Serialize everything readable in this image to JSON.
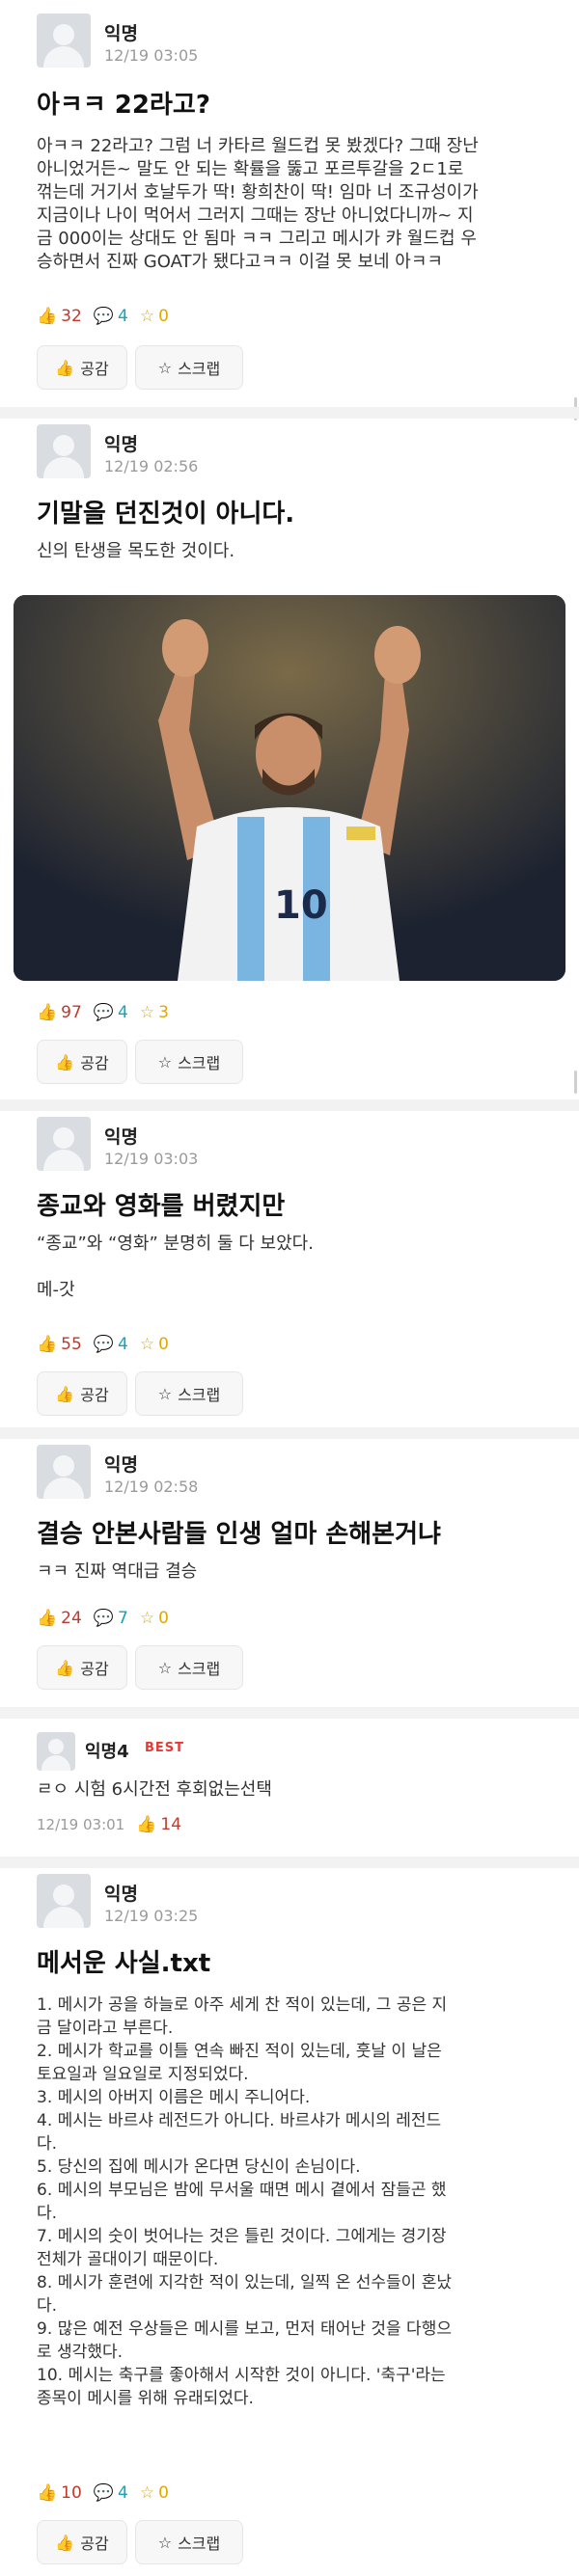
{
  "posts": [
    {
      "author": "익명",
      "date": "12/19 03:05",
      "title": "아ㅋㅋ 22라고?",
      "body": "아ㅋㅋ 22라고? 그럼 너 카타르 월드컵 못 봤겠다? 그때 장난\n아니었거든~ 말도 안 되는 확률을 뚫고 포르투갈을 2ㄷ1로\n꺾는데 거기서 호날두가 딱! 황희찬이 딱! 임마 너 조규성이가\n지금이나 나이 먹어서 그러지 그때는 장난 아니었다니까~ 지\n금 000이는 상대도 안 됨마 ㅋㅋ 그리고 메시가 캬 월드컵 우\n승하면서 진짜 GOAT가 됐다고ㅋㅋ 이걸 못 보네 아ㅋㅋ",
      "likes": "32",
      "comments": "4",
      "scraps": "0"
    },
    {
      "author": "익명",
      "date": "12/19 02:56",
      "title": "기말을 던진것이 아니다.",
      "body": "신의 탄생을 목도한 것이다.",
      "likes": "97",
      "comments": "4",
      "scraps": "3"
    },
    {
      "author": "익명",
      "date": "12/19 03:03",
      "title": "종교와 영화를 버렸지만",
      "body": "“종교”와 “영화” 분명히 둘 다 보았다.\n\n메-갓",
      "likes": "55",
      "comments": "4",
      "scraps": "0"
    },
    {
      "author": "익명",
      "date": "12/19 02:58",
      "title": "결승 안본사람들 인생 얼마 손해본거냐",
      "body": "ㅋㅋ 진짜 역대급 결승",
      "likes": "24",
      "comments": "7",
      "scraps": "0"
    },
    {
      "author": "익명",
      "date": "12/19 03:25",
      "title": "메서운 사실.txt",
      "body": "1. 메시가 공을 하늘로 아주 세게 찬 적이 있는데, 그 공은 지\n금 달이라고 부른다.\n2. 메시가 학교를 이틀 연속 빠진 적이 있는데, 훗날 이 날은\n토요일과 일요일로 지정되었다.\n3. 메시의 아버지 이름은 메시 주니어다.\n4. 메시는 바르샤 레전드가 아니다. 바르샤가 메시의 레전드\n다.\n5. 당신의 집에 메시가 온다면 당신이 손님이다.\n6. 메시의 부모님은 밤에 무서울 때면 메시 곁에서 잠들곤 했\n다.\n7. 메시의 숫이 벗어나는 것은 틀린 것이다. 그에게는 경기장\n전체가 골대이기 때문이다.\n8. 메시가 훈련에 지각한 적이 있는데, 일찍 온 선수들이 혼났\n다.\n9. 많은 예전 우상들은 메시를 보고, 먼저 태어난 것을 다행으\n로 생각했다.\n10. 메시는 축구를 좋아해서 시작한 것이 아니다. '축구'라는\n종목이 메시를 위해 유래되었다.",
      "likes": "10",
      "comments": "4",
      "scraps": "0"
    }
  ],
  "best_comment": {
    "author": "익명4",
    "badge": "BEST",
    "text": "ㄹㅇ 시험 6시간전 후회없는선택",
    "date": "12/19 03:01",
    "likes": "14"
  },
  "buttons": {
    "like_label": "공감",
    "scrap_label": "스크랩"
  },
  "icons": {
    "like": "thumbs-up-icon",
    "comment": "comment-icon",
    "scrap": "star-icon"
  },
  "colors": {
    "like": "#c0392b",
    "comment": "#17a2b8",
    "scrap": "#e0a800",
    "best": "#e53935"
  }
}
